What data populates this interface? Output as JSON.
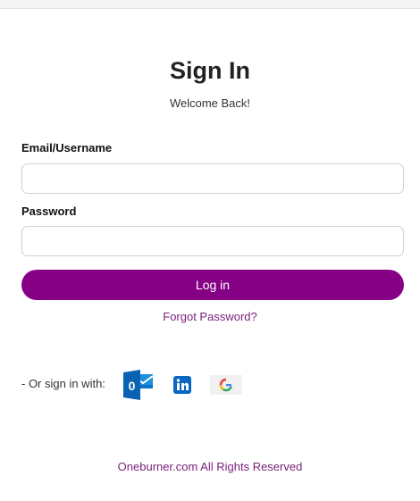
{
  "header": {
    "title": "Sign In",
    "subtitle": "Welcome Back!"
  },
  "form": {
    "email_label": "Email/Username",
    "email_value": "",
    "password_label": "Password",
    "password_value": "",
    "login_label": "Log in",
    "forgot_label": "Forgot Password?"
  },
  "sso": {
    "prompt": "- Or sign in with:",
    "providers": [
      {
        "icon": "outlook-icon",
        "color": "#0a74c8"
      },
      {
        "icon": "linkedin-icon",
        "color": "#0a66c2"
      },
      {
        "icon": "google-icon",
        "color": "#4285f4"
      }
    ]
  },
  "footer": {
    "text": "Oneburner.com All Rights Reserved"
  },
  "colors": {
    "accent": "#850084",
    "link": "#7a1f7c"
  }
}
